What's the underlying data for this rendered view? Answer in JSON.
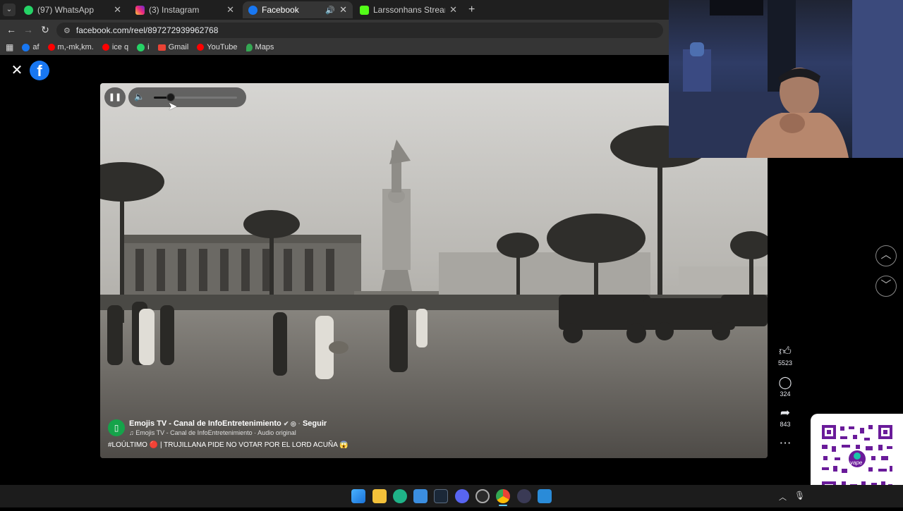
{
  "browser": {
    "tabs": [
      {
        "label": "(97) WhatsApp",
        "icon": "whatsapp-icon",
        "color": "#25d366"
      },
      {
        "label": "(3) Instagram",
        "icon": "instagram-icon",
        "color": "#e1306c"
      },
      {
        "label": "Facebook",
        "icon": "facebook-icon",
        "color": "#1877f2"
      },
      {
        "label": "Larssonhans Stream - Watch Li",
        "icon": "kick-icon",
        "color": "#53fc18"
      }
    ],
    "url": "facebook.com/reel/897272939962768",
    "bookmarks": [
      {
        "label": "af",
        "icon": "facebook-icon",
        "color": "#1877f2"
      },
      {
        "label": "m,-mk,km.",
        "icon": "youtube-icon",
        "color": "#ff0000"
      },
      {
        "label": "ice q",
        "icon": "youtube-icon",
        "color": "#ff0000"
      },
      {
        "label": "i",
        "icon": "whatsapp-icon",
        "color": "#25d366"
      },
      {
        "label": "Gmail",
        "icon": "gmail-icon",
        "color": "#ea4335"
      },
      {
        "label": "YouTube",
        "icon": "youtube-icon",
        "color": "#ff0000"
      },
      {
        "label": "Maps",
        "icon": "maps-icon",
        "color": "#34a853"
      }
    ]
  },
  "reel": {
    "volume_level": 0.2,
    "channel_name": "Emojis TV - Canal de InfoEntretenimiento",
    "follow_label": "Seguir",
    "audio_line": "Emojis TV - Canal de InfoEntretenimiento · Audio original",
    "caption": "#LOÚLTIMO 🔴 | TRUJILLANA PIDE NO VOTAR POR EL LORD ACUÑA 😱",
    "actions": {
      "likes": "5523",
      "comments": "324",
      "shares": "843"
    }
  },
  "colors": {
    "brand": "#1877f2",
    "qr_accent": "#6a1b9a"
  },
  "overlay": {
    "qr_brand": "yape"
  }
}
